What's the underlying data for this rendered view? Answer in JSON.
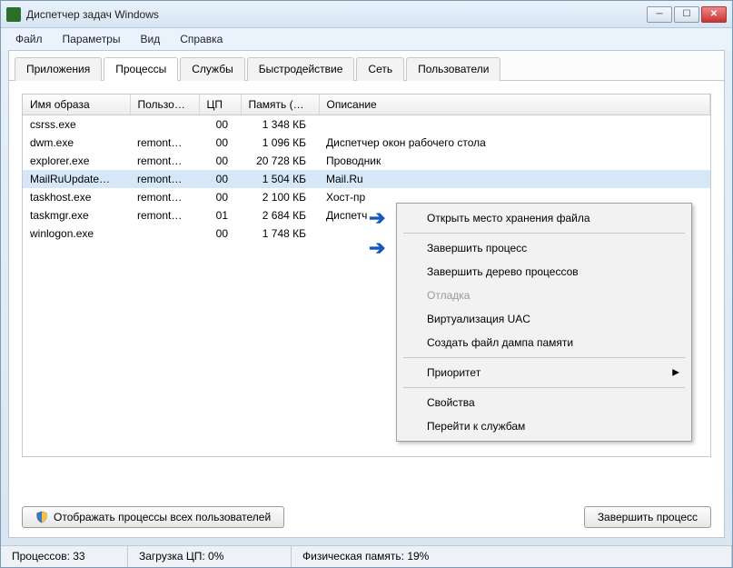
{
  "window": {
    "title": "Диспетчер задач Windows"
  },
  "menu": {
    "file": "Файл",
    "options": "Параметры",
    "view": "Вид",
    "help": "Справка"
  },
  "tabs": {
    "applications": "Приложения",
    "processes": "Процессы",
    "services": "Службы",
    "performance": "Быстродействие",
    "network": "Сеть",
    "users": "Пользователи"
  },
  "columns": {
    "image": "Имя образа",
    "user": "Пользо…",
    "cpu": "ЦП",
    "memory": "Память (…",
    "description": "Описание"
  },
  "rows": [
    {
      "image": "csrss.exe",
      "user": "",
      "cpu": "00",
      "memory": "1 348 КБ",
      "description": ""
    },
    {
      "image": "dwm.exe",
      "user": "remont…",
      "cpu": "00",
      "memory": "1 096 КБ",
      "description": "Диспетчер окон рабочего стола"
    },
    {
      "image": "explorer.exe",
      "user": "remont…",
      "cpu": "00",
      "memory": "20 728 КБ",
      "description": "Проводник"
    },
    {
      "image": "MailRuUpdate…",
      "user": "remont…",
      "cpu": "00",
      "memory": "1 504 КБ",
      "description": "Mail.Ru",
      "selected": true
    },
    {
      "image": "taskhost.exe",
      "user": "remont…",
      "cpu": "00",
      "memory": "2 100 КБ",
      "description": "Хост-пр"
    },
    {
      "image": "taskmgr.exe",
      "user": "remont…",
      "cpu": "01",
      "memory": "2 684 КБ",
      "description": "Диспетч"
    },
    {
      "image": "winlogon.exe",
      "user": "",
      "cpu": "00",
      "memory": "1 748 КБ",
      "description": ""
    }
  ],
  "buttons": {
    "show_all": "Отображать процессы всех пользователей",
    "end_process": "Завершить процесс"
  },
  "status": {
    "processes": "Процессов: 33",
    "cpu": "Загрузка ЦП: 0%",
    "mem": "Физическая память: 19%"
  },
  "context_menu": {
    "open_location": "Открыть место хранения файла",
    "end_process": "Завершить процесс",
    "end_tree": "Завершить дерево процессов",
    "debug": "Отладка",
    "uac": "Виртуализация UAC",
    "dump": "Создать файл дампа памяти",
    "priority": "Приоритет",
    "properties": "Свойства",
    "goto_services": "Перейти к службам"
  }
}
